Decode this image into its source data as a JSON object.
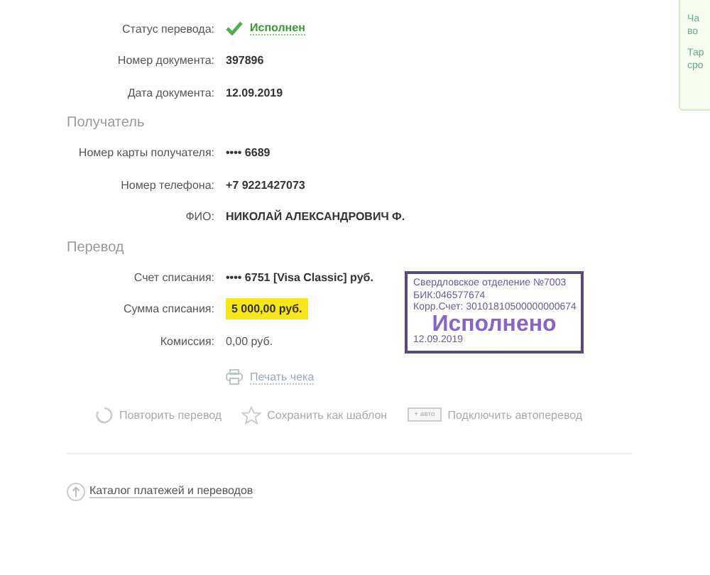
{
  "status_row": {
    "label": "Статус перевода:",
    "value": "Исполнен"
  },
  "doc_rows": [
    {
      "label": "Номер документа:",
      "value": "397896"
    },
    {
      "label": "Дата документа:",
      "value": "12.09.2019"
    }
  ],
  "recipient": {
    "title": "Получатель",
    "rows": [
      {
        "label": "Номер карты получателя:",
        "value": "•••• 6689"
      },
      {
        "label": "Номер телефона:",
        "value": "+7 9221427073"
      },
      {
        "label": "ФИО:",
        "value": "НИКОЛАЙ АЛЕКСАНДРОВИЧ Ф."
      }
    ]
  },
  "transfer": {
    "title": "Перевод",
    "rows": [
      {
        "label": "Счет списания:",
        "value": "•••• 6751 [Visa Classic] руб.",
        "kind": "bold"
      },
      {
        "label": "Сумма списания:",
        "value": "5 000,00 руб.",
        "kind": "highlight"
      },
      {
        "label": "Комиссия:",
        "value": "0,00 руб.",
        "kind": "plain"
      }
    ]
  },
  "stamp": {
    "lines": [
      "Свердловское отделение №7003",
      "БИК:046577674",
      "Корр.Счет: 30101810500000000674"
    ],
    "status": "Исполнено",
    "date": "12.09.2019"
  },
  "print_link": "Печать чека",
  "actions": [
    {
      "kind": "repeat",
      "label": "Повторить перевод"
    },
    {
      "kind": "template",
      "label": "Сохранить как шаблон"
    },
    {
      "kind": "auto",
      "badge": "+ авто",
      "label": "Подключить автоперевод"
    }
  ],
  "catalog_link": "Каталог платежей и переводов",
  "side_panel": {
    "paragraphs": [
      [
        "Ча",
        "во"
      ],
      [
        "Тар",
        "сро"
      ]
    ]
  }
}
